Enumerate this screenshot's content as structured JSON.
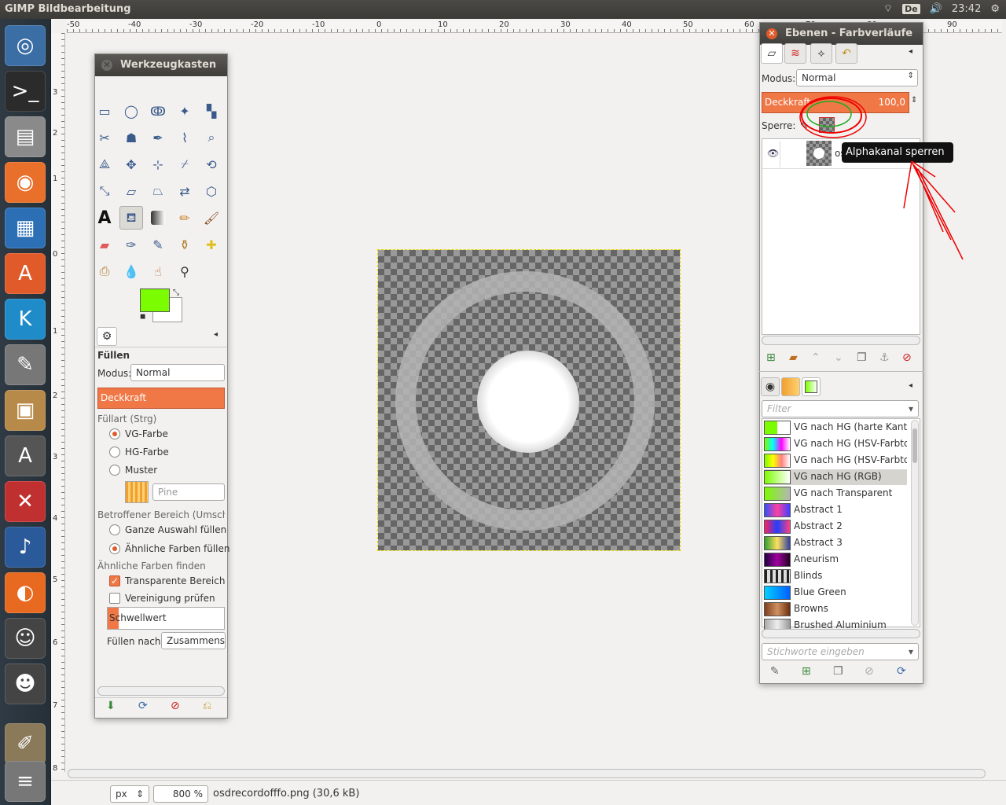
{
  "topbar": {
    "title": "GIMP Bildbearbeitung",
    "keyboard": "De",
    "time": "23:42"
  },
  "launcher": {
    "items": [
      "ubuntu-logo-icon",
      "terminal-icon",
      "files-icon",
      "firefox-icon",
      "writer-icon",
      "software-center-icon",
      "kodi-icon",
      "disks-icon",
      "archive-icon",
      "update-icon",
      "settings-icon",
      "music-icon",
      "fish-icon",
      "tux-icon",
      "tux-game-icon",
      "gimp-icon",
      "stack-icon"
    ]
  },
  "rulers": {
    "h_labels": [
      "-50",
      "-40",
      "-30",
      "-20",
      "-10",
      "0",
      "10",
      "20",
      "30",
      "40",
      "50",
      "60",
      "70",
      "80",
      "90"
    ],
    "v_labels": [
      "3",
      "0",
      "2",
      "0",
      "1",
      "0",
      "0",
      "1",
      "0",
      "2",
      "0",
      "3",
      "0",
      "4",
      "0",
      "5",
      "0",
      "6",
      "0",
      "7",
      "0",
      "8"
    ]
  },
  "status": {
    "unit": "px",
    "zoom": "800 %",
    "filename": "osdrecordofffo.png (30,6 kB)"
  },
  "toolbox": {
    "title": "Werkzeugkasten",
    "options_title": "Füllen",
    "mode_label": "Modus:",
    "mode_value": "Normal",
    "opacity_label": "Deckkraft",
    "filltype_label": "Füllart  (Strg)",
    "fill_fg": "VG-Farbe",
    "fill_bg": "HG-Farbe",
    "fill_pattern": "Muster",
    "pattern_name": "Pine",
    "area_label": "Betroffener Bereich (Umscha",
    "area_all": "Ganze Auswahl füllen",
    "area_similar": "Ähnliche Farben füllen",
    "find_label": "Ähnliche Farben finden",
    "transparent": "Transparente Bereiche",
    "merged": "Vereinigung prüfen",
    "threshold": "Schwellwert",
    "fill_by_label": "Füllen nach:",
    "fill_by_value": "Zusammenset",
    "fg_color": "#7cfc00",
    "bg_color": "#ffffff"
  },
  "layers": {
    "title": "Ebenen - Farbverläufe",
    "mode_label": "Modus:",
    "mode_value": "Normal",
    "opacity_label": "Deckkraft",
    "opacity_value": "100,0",
    "lock_label": "Sperre:",
    "layer_name": "os",
    "tooltip": "Alphakanal sperren"
  },
  "gradients": {
    "filter_placeholder": "Filter",
    "tags_placeholder": "Stichworte eingeben",
    "items": [
      {
        "name": "VG nach HG (harte Kante)",
        "css": "linear-gradient(90deg,#7cfc00 50%,#fff 50%)"
      },
      {
        "name": "VG nach HG (HSV-Farbton g",
        "css": "linear-gradient(90deg,#7cfc00,#00ffff,#ff00ff,#fff)"
      },
      {
        "name": "VG nach HG (HSV-Farbton i",
        "css": "linear-gradient(90deg,#7cfc00,#ffff00,#ff8080,#fff)"
      },
      {
        "name": "VG nach HG (RGB)",
        "css": "linear-gradient(90deg,#7cfc00,#fff)"
      },
      {
        "name": "VG nach Transparent",
        "css": "linear-gradient(90deg,#7cfc00,#b5b5b5)"
      },
      {
        "name": "Abstract 1",
        "css": "linear-gradient(90deg,#3050ff,#ff40a0,#4040ff)"
      },
      {
        "name": "Abstract 2",
        "css": "linear-gradient(90deg,#ff2060,#2040ff,#ff4080)"
      },
      {
        "name": "Abstract 3",
        "css": "linear-gradient(90deg,#30a030,#ffe060,#3040a0)"
      },
      {
        "name": "Aneurism",
        "css": "linear-gradient(90deg,#200040,#a000a0,#200020)"
      },
      {
        "name": "Blinds",
        "css": "repeating-linear-gradient(90deg,#222 0 3px,#ddd 3px 7px)"
      },
      {
        "name": "Blue Green",
        "css": "linear-gradient(90deg,#00d0ff,#0060ff)"
      },
      {
        "name": "Browns",
        "css": "linear-gradient(90deg,#804020,#d09060,#6a3010)"
      },
      {
        "name": "Brushed Aluminium",
        "css": "linear-gradient(90deg,#aaa,#eee,#999)"
      }
    ]
  }
}
